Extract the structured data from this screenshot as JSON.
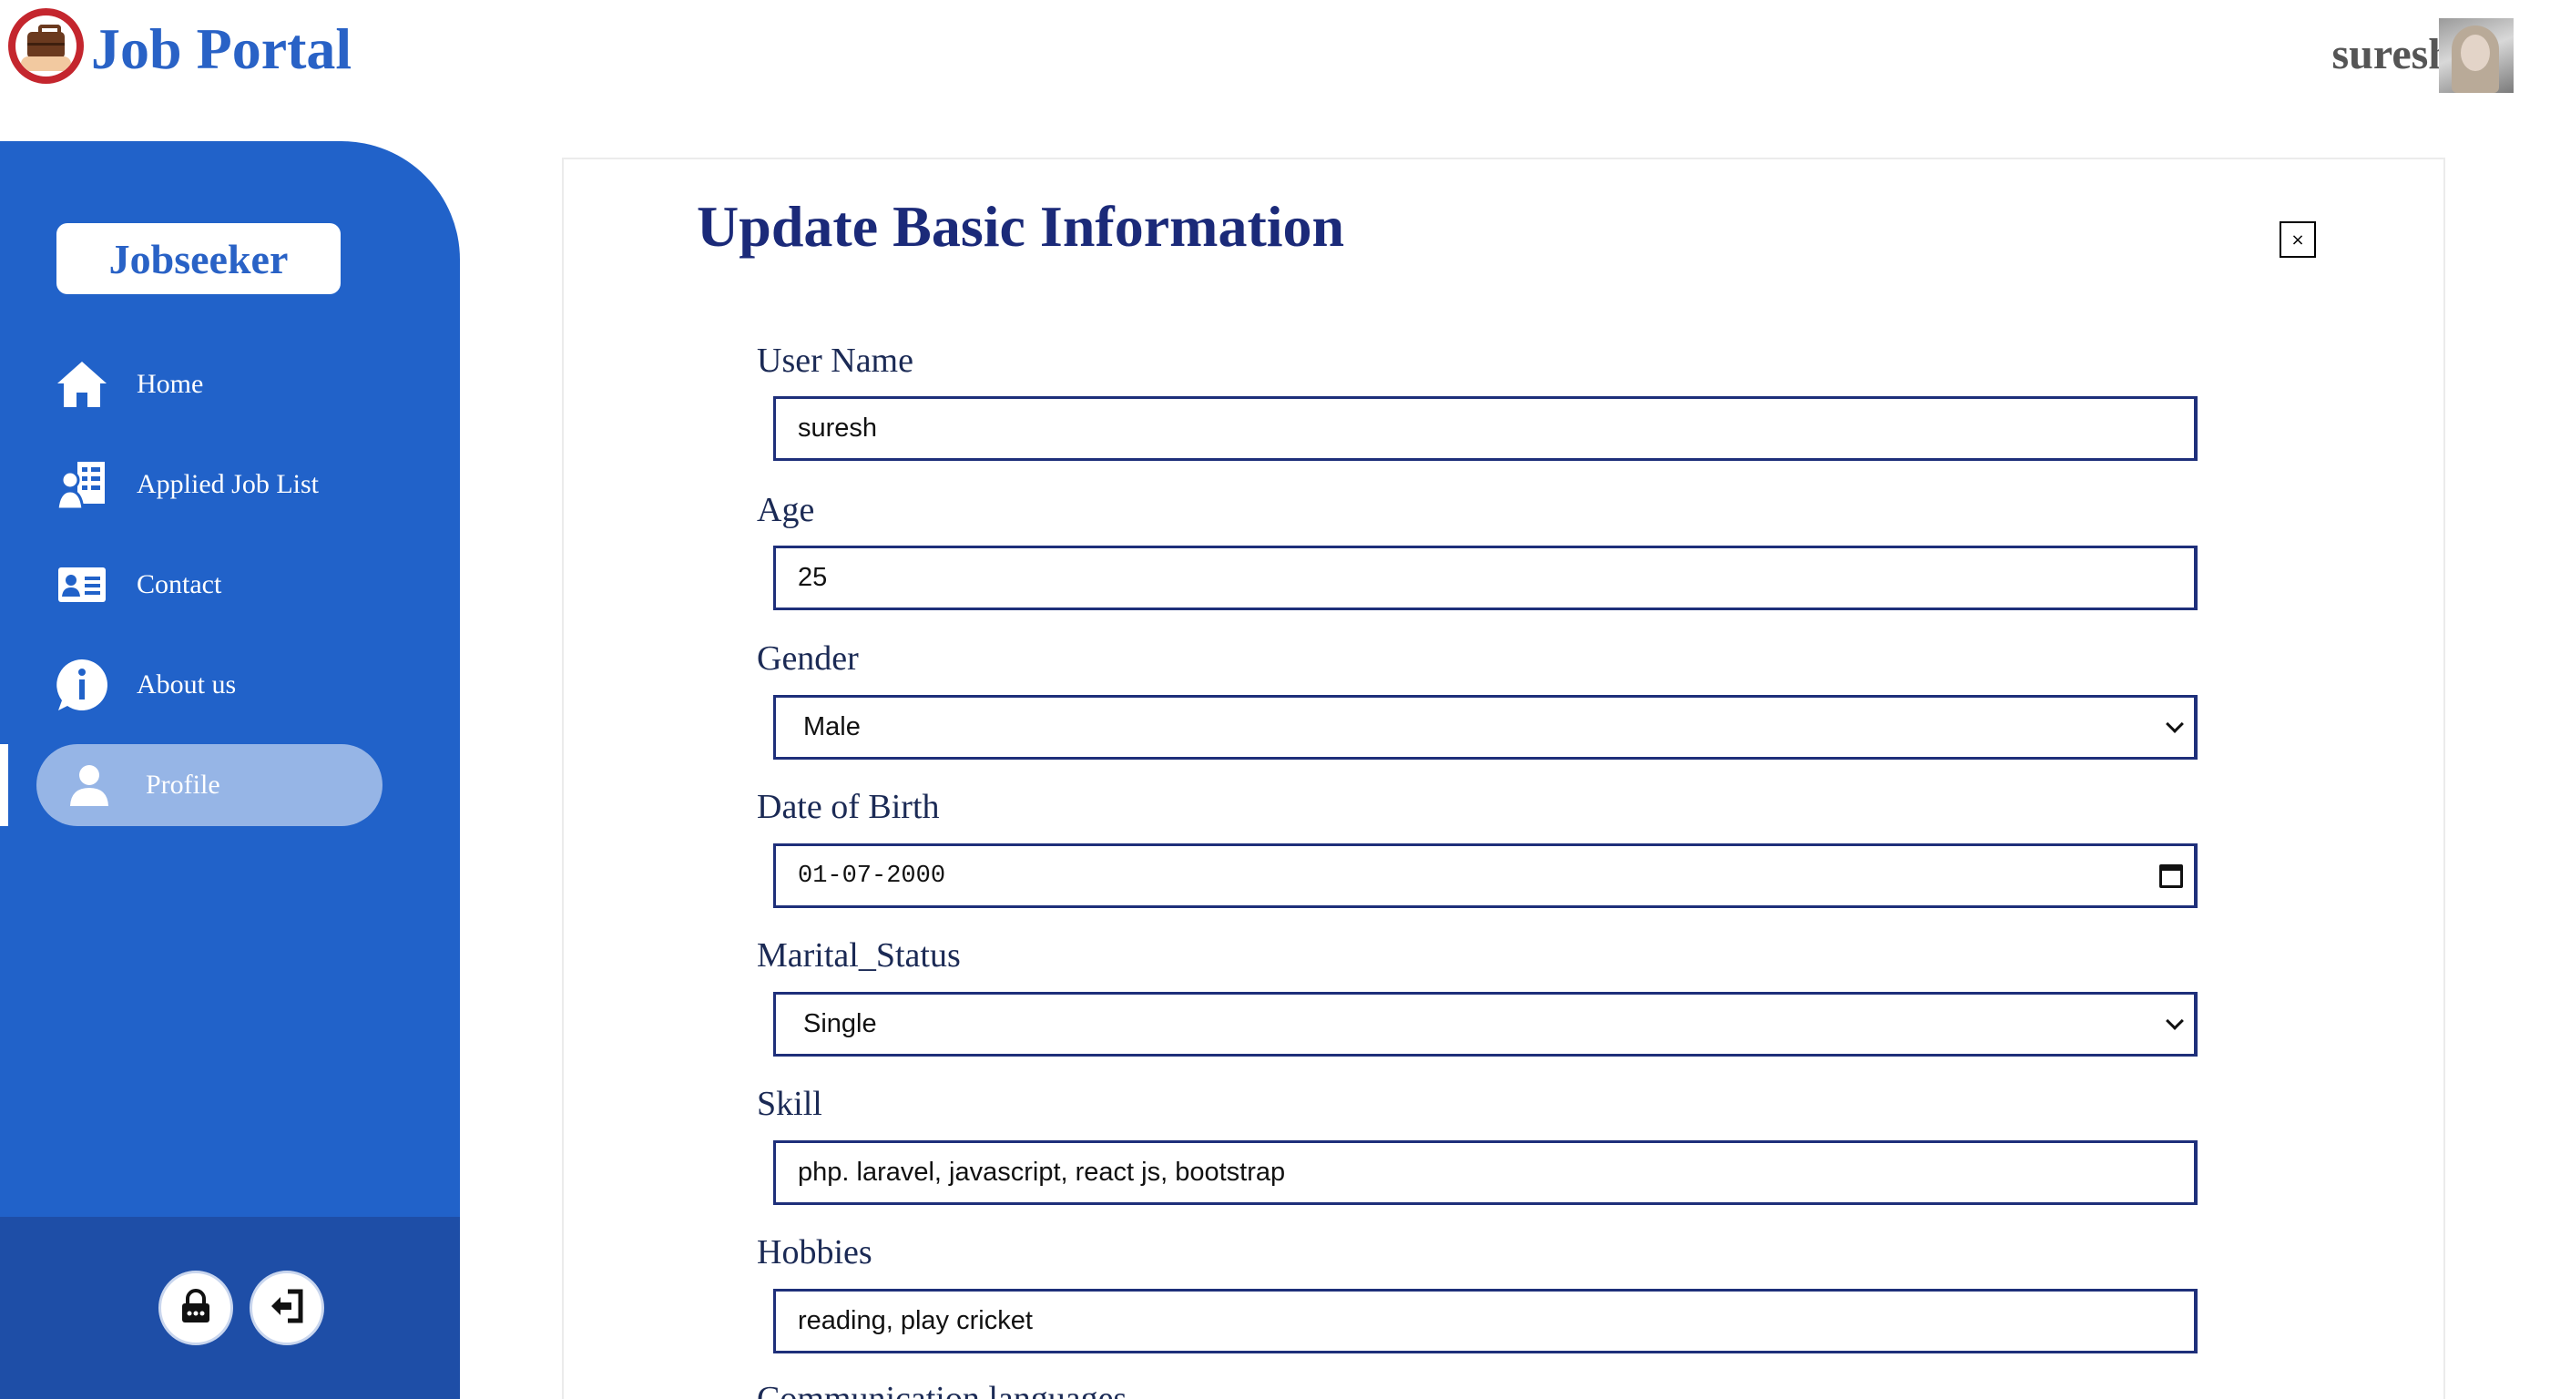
{
  "header": {
    "brand": "Job Portal",
    "user_name": "suresh"
  },
  "sidebar": {
    "role": "Jobseeker",
    "items": [
      {
        "label": "Home",
        "icon": "home-icon"
      },
      {
        "label": "Applied Job List",
        "icon": "job-list-icon"
      },
      {
        "label": "Contact",
        "icon": "contact-card-icon"
      },
      {
        "label": "About us",
        "icon": "info-icon"
      },
      {
        "label": "Profile",
        "icon": "user-icon",
        "active": true
      }
    ],
    "footer_buttons": [
      {
        "icon": "lock-icon"
      },
      {
        "icon": "logout-icon"
      }
    ]
  },
  "form": {
    "title": "Update Basic Information",
    "close_label": "×",
    "fields": {
      "user_name": {
        "label": "User Name",
        "value": "suresh"
      },
      "age": {
        "label": "Age",
        "value": "25"
      },
      "gender": {
        "label": "Gender",
        "value": "Male"
      },
      "dob": {
        "label": "Date of Birth",
        "value": "01-07-2000"
      },
      "marital_status": {
        "label": "Marital_Status",
        "value": "Single"
      },
      "skill": {
        "label": "Skill",
        "value": "php. laravel, javascript, react js, bootstrap"
      },
      "hobbies": {
        "label": "Hobbies",
        "value": "reading, play cricket"
      },
      "communication_languages": {
        "label": "Communication languages"
      }
    }
  },
  "colors": {
    "brand_blue": "#2962c6",
    "sidebar_blue": "#2162c9",
    "sidebar_footer": "#1e4ea7",
    "active_pill": "#96b5e6",
    "title_navy": "#1b2a79",
    "field_border": "#1e2f7a"
  }
}
